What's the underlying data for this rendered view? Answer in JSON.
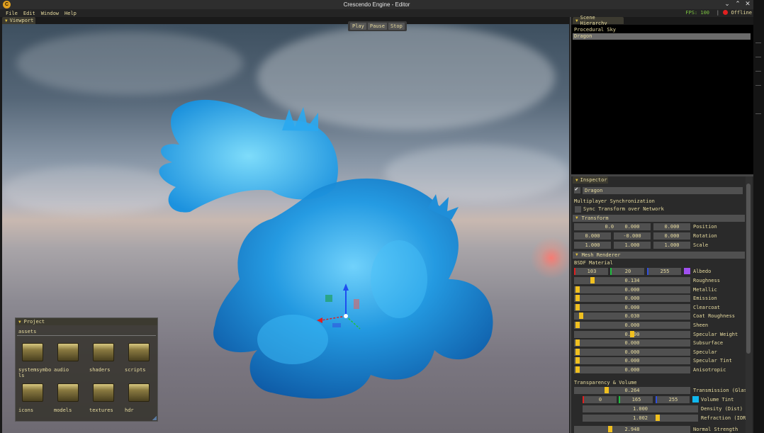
{
  "app": {
    "title": "Crescendo Engine - Editor",
    "icon": "C"
  },
  "menu": [
    "File",
    "Edit",
    "Window",
    "Help"
  ],
  "status": {
    "fps": "FPS: 100",
    "separator": "|",
    "connection": "Offline"
  },
  "viewport": {
    "tab": "Viewport",
    "controls": [
      "Play",
      "Pause",
      "Stop"
    ]
  },
  "project": {
    "tab": "Project",
    "path": "assets",
    "folders": [
      "systemsymbo ls",
      "audio",
      "shaders",
      "scripts",
      "icons",
      "models",
      "textures",
      "hdr"
    ]
  },
  "hierarchy": {
    "tab": "Scene Hierarchy",
    "items": [
      "Procedural Sky",
      "Dragon"
    ],
    "selected": "Dragon"
  },
  "inspector": {
    "tab": "Inspector",
    "object_name": "Dragon",
    "multiplayer": "Multiplayer Synchronization",
    "sync_label": "Sync Transform over Network",
    "transform": {
      "header": "Transform",
      "position": {
        "label": "Position",
        "values": [
          "0.000",
          "0.000",
          "0.000"
        ]
      },
      "rotation": {
        "label": "Rotation",
        "values": [
          "0.000",
          "-0.000",
          "0.000"
        ]
      },
      "scale": {
        "label": "Scale",
        "values": [
          "1.000",
          "1.000",
          "1.000"
        ]
      }
    },
    "mesh_renderer": {
      "header": "Mesh Renderer",
      "material": "BSDF Material",
      "albedo": {
        "label": "Albedo",
        "values": [
          "103",
          "20",
          "255"
        ],
        "swatch": "#a050f0"
      },
      "sliders": [
        {
          "label": "Roughness",
          "value": "0.134",
          "fraction": 0.134
        },
        {
          "label": "Metallic",
          "value": "0.000",
          "fraction": 0
        },
        {
          "label": "Emission",
          "value": "0.000",
          "fraction": 0
        },
        {
          "label": "Clearcoat",
          "value": "0.000",
          "fraction": 0
        },
        {
          "label": "Coat Roughness",
          "value": "0.030",
          "fraction": 0.03
        },
        {
          "label": "Sheen",
          "value": "0.000",
          "fraction": 0
        },
        {
          "label": "Specular Weight",
          "value": "0.500",
          "fraction": 0.5
        },
        {
          "label": "Subsurface",
          "value": "0.000",
          "fraction": 0
        },
        {
          "label": "Specular",
          "value": "0.000",
          "fraction": 0
        },
        {
          "label": "Specular Tint",
          "value": "0.000",
          "fraction": 0
        },
        {
          "label": "Anisotropic",
          "value": "0.000",
          "fraction": 0
        }
      ],
      "transparency_header": "Transparency & Volume",
      "transmission": {
        "label": "Transmission (Glass)",
        "value": "0.264",
        "fraction": 0.264
      },
      "volume_tint": {
        "label": "Volume Tint",
        "values": [
          "0",
          "165",
          "255"
        ],
        "swatch": "#10b8f0"
      },
      "density": {
        "label": "Density (Dist)",
        "value": "1.000"
      },
      "refraction": {
        "label": "Refraction (IOR)",
        "value": "1.002",
        "fraction": 0.66
      },
      "normal_strength": {
        "label": "Normal Strength",
        "value": "2.948",
        "fraction": 0.3
      }
    }
  },
  "colors": {
    "accent": "#f0c020",
    "fps": "#7cc440",
    "offline_dot": "#e02020",
    "dragon": "#1fa0e8"
  }
}
